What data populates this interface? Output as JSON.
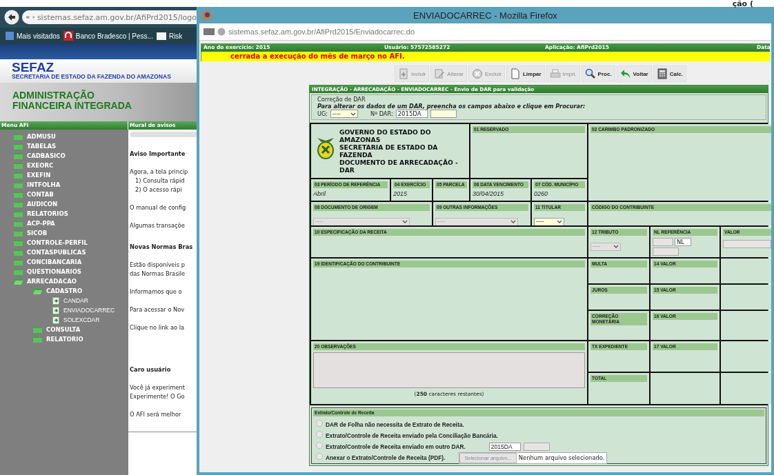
{
  "top_fragment": "ção (",
  "background_browser": {
    "url": "sistemas.sefaz.am.gov.br/AfiPrd2015/logo",
    "bookmarks": [
      {
        "label": "Mais visitados",
        "kind": "star"
      },
      {
        "label": "Banco Bradesco | Pess...",
        "kind": "bank"
      },
      {
        "label": "Risk",
        "kind": "folder"
      }
    ],
    "brand": {
      "name": "SEFAZ",
      "subtitle": "SECRETARIA DE ESTADO DA FAZENDA DO AMAZONAS"
    },
    "banner": {
      "lines": [
        "ADMINISTRAÇÃO",
        "FINANCEIRA INTEGRADA"
      ]
    },
    "menu": {
      "title": "Menu AFI",
      "items": [
        {
          "label": "ADMUSU",
          "kind": "folder",
          "expanded": false
        },
        {
          "label": "TABELAS",
          "kind": "folder",
          "expanded": false
        },
        {
          "label": "CADBASICO",
          "kind": "folder",
          "expanded": false
        },
        {
          "label": "EXEORC",
          "kind": "folder",
          "expanded": false
        },
        {
          "label": "EXEFIN",
          "kind": "folder",
          "expanded": false
        },
        {
          "label": "INTFOLHA",
          "kind": "folder",
          "expanded": false
        },
        {
          "label": "CONTAB",
          "kind": "folder",
          "expanded": false
        },
        {
          "label": "AUDICON",
          "kind": "folder",
          "expanded": false
        },
        {
          "label": "RELATORIOS",
          "kind": "folder",
          "expanded": false
        },
        {
          "label": "ACP-PPA",
          "kind": "folder",
          "expanded": false
        },
        {
          "label": "SICOB",
          "kind": "folder",
          "expanded": false
        },
        {
          "label": "CONTROLE-PERFIL",
          "kind": "folder",
          "expanded": false
        },
        {
          "label": "CONTASPUBLICAS",
          "kind": "folder",
          "expanded": false
        },
        {
          "label": "CONCIBANCARIA",
          "kind": "folder",
          "expanded": false
        },
        {
          "label": "QUESTIONARIOS",
          "kind": "folder",
          "expanded": false
        },
        {
          "label": "ARRECADACAO",
          "kind": "folder",
          "expanded": true,
          "children": [
            {
              "label": "CADASTRO",
              "kind": "folder",
              "expanded": true,
              "children": [
                {
                  "label": "CANDAR",
                  "kind": "page"
                },
                {
                  "label": "ENVIADOCARREC",
                  "kind": "page"
                },
                {
                  "label": "SOLEXCDAR",
                  "kind": "page"
                }
              ]
            },
            {
              "label": "CONSULTA",
              "kind": "folder",
              "expanded": false
            },
            {
              "label": "RELATORIO",
              "kind": "folder",
              "expanded": false
            }
          ]
        }
      ]
    },
    "mural": {
      "title": "Mural de avisos",
      "blocks": [
        {
          "kind": "heading",
          "lines": [
            "Aviso Importante"
          ]
        },
        {
          "kind": "text",
          "lines": [
            "Agora, a tela princip"
          ]
        },
        {
          "kind": "list",
          "lines": [
            "1) Consulta rápid",
            "2) O acesso rápi"
          ]
        },
        {
          "kind": "text",
          "lines": [
            "O manual de config"
          ]
        },
        {
          "kind": "text",
          "lines": [
            "Algumas transaçõe"
          ]
        },
        {
          "kind": "heading",
          "lines": [
            "Novas Normas Bras"
          ]
        },
        {
          "kind": "text",
          "lines": [
            "Estão disponíveis p",
            "das Normas Brasile"
          ]
        },
        {
          "kind": "text",
          "lines": [
            "Informamos que o"
          ]
        },
        {
          "kind": "text",
          "lines": [
            "Para acessar o Nov"
          ]
        },
        {
          "kind": "text",
          "lines": [
            "Clique no link ao la"
          ]
        },
        {
          "kind": "heading",
          "lines": [
            "Caro usuário"
          ]
        },
        {
          "kind": "text",
          "lines": [
            "Você já experiment",
            "Experimente! O Go"
          ]
        },
        {
          "kind": "text",
          "lines": [
            "O AFI será melhor"
          ]
        }
      ]
    }
  },
  "popup": {
    "title": "ENVIADOCARREC - Mozilla Firefox",
    "url": "sistemas.sefaz.am.gov.br/AfiPrd2015/Enviadocarrec.do",
    "info_bar": [
      "Ano do exercício: 2015",
      "Usuário: 57572585272",
      "Aplicação: AfiPrd2015",
      "Data"
    ],
    "alert": "cerrada a execução do mês de março no AFI.",
    "toolbar": [
      {
        "label": "Incluir",
        "kind": "add",
        "disabled": true
      },
      {
        "label": "Alterar",
        "kind": "edit",
        "disabled": true
      },
      {
        "label": "Excluir",
        "kind": "delete",
        "disabled": true
      },
      {
        "label": "Limpar",
        "kind": "clear",
        "disabled": false
      },
      {
        "label": "Impri.",
        "kind": "print",
        "disabled": true
      },
      {
        "label": "Proc.",
        "kind": "search",
        "disabled": false
      },
      {
        "label": "Voltar",
        "kind": "back",
        "disabled": false
      },
      {
        "label": "Calc.",
        "kind": "calc",
        "disabled": false
      }
    ],
    "form": {
      "title": "INTEGRAÇÃO - ARRECADAÇÃO - ENVIADOCARREC - Envio de DAR para validação",
      "correction": {
        "legend": "Correção de DAR",
        "instruction": "Para alterar os dados de um DAR, preencha os campos abaixo e clique em Procurar:",
        "ug_label": "UG:",
        "ug_value": "----",
        "dar_label": "Nº DAR:",
        "dar_value": "2015DA"
      },
      "cells": [
        {
          "kind": "header",
          "lines": [
            "GOVERNO DO ESTADO DO AMAZONAS",
            "SECRETARIA DE ESTADO DA FAZENDA",
            "DOCUMENTO DE ARRECADAÇÃO - DAR"
          ]
        },
        {
          "kind": "text",
          "label": "01 RESERVADO"
        },
        {
          "kind": "text",
          "label": "02 CARIMBO PADRONIZADO"
        },
        {
          "kind": "text",
          "label": "03 PERÍODO DE REFERÊNCIA",
          "value": "Abril"
        },
        {
          "kind": "text",
          "label": "04 EXERCÍCIO",
          "value": "2015"
        },
        {
          "kind": "text",
          "label": "05 PARCELA"
        },
        {
          "kind": "text",
          "label": "06 DATA VENCIMENTO",
          "value": "30/04/2015"
        },
        {
          "kind": "text",
          "label": "07 CÓD. MUNICÍPIO",
          "value": "0260"
        },
        {
          "kind": "select",
          "label": "08 DOCUMENTO DE ORIGEM",
          "value": "----",
          "disabled": true
        },
        {
          "kind": "select",
          "label": "09 OUTRAS INFORMAÇÕES",
          "value": "----",
          "disabled": true
        },
        {
          "kind": "select",
          "label": "11 TITULAR",
          "value": "----",
          "disabled": false
        },
        {
          "kind": "text",
          "label": "CÓDIGO DO CONTRIBUINTE"
        },
        {
          "kind": "text",
          "label": "10 ESPECIFICAÇÃO DA RECEITA"
        },
        {
          "kind": "select",
          "label": "12 TRIBUTO",
          "value": "----",
          "disabled": true
        },
        {
          "kind": "nl",
          "label": "NL REFERÊNCIA",
          "value": "NL"
        },
        {
          "kind": "input",
          "label": "VALOR"
        },
        {
          "kind": "text",
          "label": "19 IDENTIFICAÇÃO DO CONTRIBUINTE"
        },
        {
          "kind": "text",
          "label": "MULTA"
        },
        {
          "kind": "text",
          "label": "14 VALOR"
        },
        {
          "kind": "text",
          "label": "JUROS"
        },
        {
          "kind": "text",
          "label": "15 VALOR"
        },
        {
          "kind": "text",
          "label": "CORREÇÃO MONETÁRIA"
        },
        {
          "kind": "text",
          "label": "16 VALOR"
        },
        {
          "kind": "textarea",
          "label": "20 OBSERVAÇÕES",
          "counter": "(**250** caracteres restantes)"
        },
        {
          "kind": "text",
          "label": "TX EXPEDIENTE"
        },
        {
          "kind": "text",
          "label": "17 VALOR"
        },
        {
          "kind": "text",
          "label": "TOTAL"
        }
      ],
      "extract": {
        "title": "Extrato/Controle de Receita",
        "options": [
          {
            "kind": "plain",
            "label": "DAR de Folha não necessita de Extrato de Receita.",
            "selected": false
          },
          {
            "kind": "plain",
            "label": "Extrato/Controle de Receita enviado pela Conciliação Bancária.",
            "selected": false
          },
          {
            "kind": "dar",
            "label": "Extrato/Controle de Receita enviado em outro DAR.",
            "value": "2015DA",
            "selected": false
          },
          {
            "kind": "file",
            "label": "Anexar o Extrato/Controle de Receita (PDF).",
            "button": "Selecionar arquivo...",
            "status": "Nenhum arquivo selecionado.",
            "selected": false
          }
        ]
      }
    }
  }
}
